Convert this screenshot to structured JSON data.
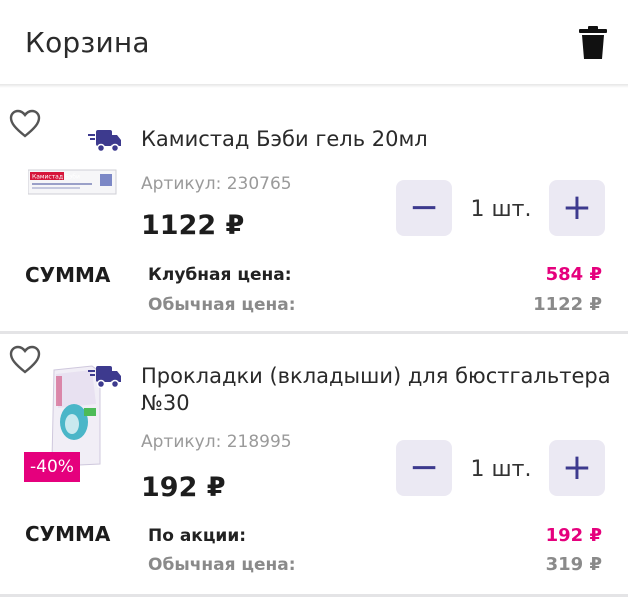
{
  "header": {
    "title": "Корзина",
    "trash_icon": "trash-icon"
  },
  "colors": {
    "accent": "#e5007d",
    "qty_button_bg": "#ebe9f3",
    "qty_button_fg": "#3d3a8e",
    "delivery_icon": "#3d3a8e"
  },
  "items": [
    {
      "name": "Камистад Бэби гель 20мл",
      "sku": "Артикул: 230765",
      "price": "1122 ₽",
      "qty": "1 шт.",
      "minus": "−",
      "plus": "+",
      "summa_label": "СУММА",
      "price_label_1": "Клубная цена:",
      "price_value_1": "584 ₽",
      "price_label_2": "Обычная цена:",
      "price_value_2": "1122 ₽",
      "package_text": "Камистад Бэби"
    },
    {
      "name": "Прокладки (вкладыши) для бюстгальтера №30",
      "sku": "Артикул: 218995",
      "price": "192 ₽",
      "qty": "1 шт.",
      "minus": "−",
      "plus": "+",
      "summa_label": "СУММА",
      "price_label_1": "По акции:",
      "price_value_1": "192 ₽",
      "price_label_2": "Обычная цена:",
      "price_value_2": "319 ₽",
      "discount": "-40%"
    }
  ]
}
